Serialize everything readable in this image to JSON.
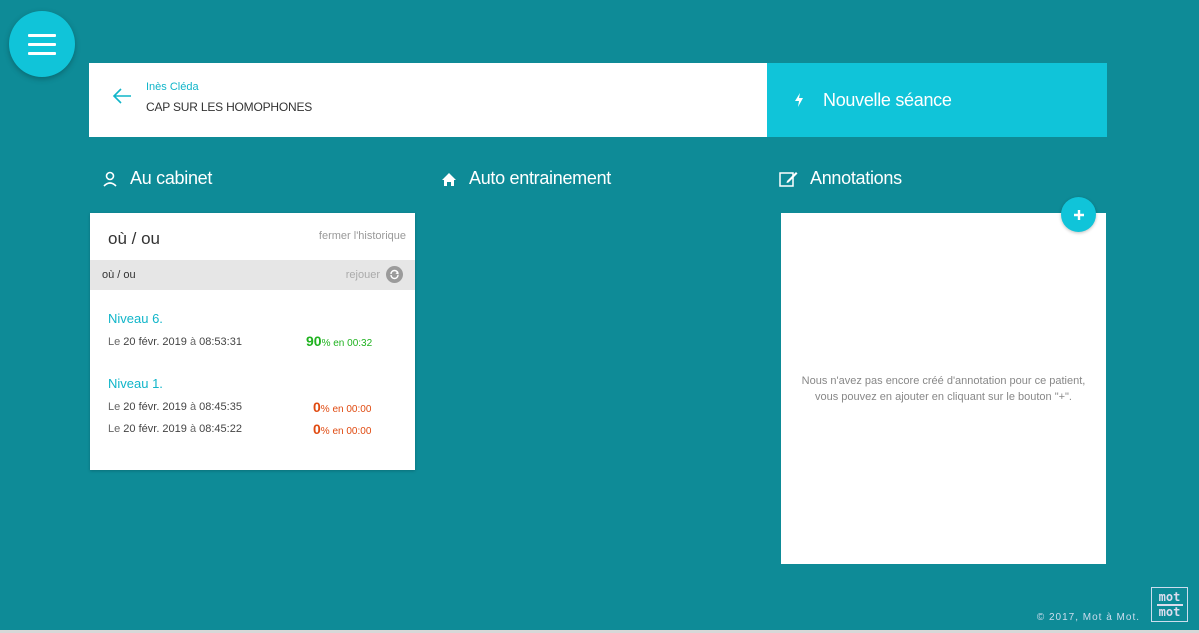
{
  "header": {
    "patient_name": "Inès Cléda",
    "exercise_name": "CAP SUR LES HOMOPHONES",
    "new_session_label": "Nouvelle séance"
  },
  "sections": {
    "cabinet": "Au cabinet",
    "auto": "Auto entrainement",
    "annotations": "Annotations"
  },
  "history_card": {
    "title": "où / ou",
    "close_label": "fermer l'historique",
    "subtitle": "où / ou",
    "replay_label": "rejouer",
    "levels": [
      {
        "name": "Niveau 6.",
        "entries": [
          {
            "prefix": "Le ",
            "date": "20 févr. 2019",
            "mid": " à ",
            "time": "08:53:31",
            "percent": "90",
            "unit": "% en ",
            "duration": "00:32",
            "status": "good"
          }
        ]
      },
      {
        "name": "Niveau 1.",
        "entries": [
          {
            "prefix": "Le ",
            "date": "20 févr. 2019",
            "mid": " à ",
            "time": "08:45:35",
            "percent": "0",
            "unit": "% en ",
            "duration": "00:00",
            "status": "bad"
          },
          {
            "prefix": "Le ",
            "date": "20 févr. 2019",
            "mid": " à ",
            "time": "08:45:22",
            "percent": "0",
            "unit": "% en ",
            "duration": "00:00",
            "status": "bad"
          }
        ]
      }
    ]
  },
  "annotations": {
    "empty_line1": "Nous n'avez pas encore créé d'annotation pour ce patient,",
    "empty_line2": "vous pouvez en ajouter en cliquant sur le bouton \"+\"."
  },
  "footer": {
    "copyright": "© 2017, Mot à Mot.",
    "logo_top": "mot",
    "logo_bottom": "mot"
  },
  "colors": {
    "background": "#0e8b97",
    "accent": "#10c4d9",
    "success": "#1fb21f",
    "danger": "#e04a10"
  },
  "icons": {
    "menu": "hamburger-icon",
    "back": "arrow-left-icon",
    "new_session": "lightning-icon",
    "cabinet": "user-icon",
    "auto": "home-icon",
    "annotations": "edit-icon",
    "replay": "replay-icon",
    "add": "plus-icon"
  }
}
